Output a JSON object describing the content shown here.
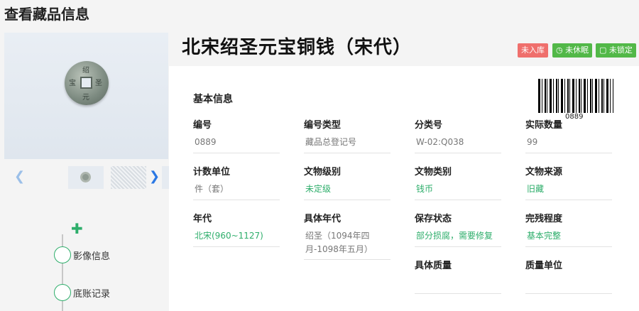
{
  "page": {
    "title": "查看藏品信息"
  },
  "object": {
    "title": "北宋绍圣元宝铜钱（宋代）",
    "coin_inscription": [
      "绍",
      "圣",
      "元",
      "宝"
    ]
  },
  "badges": [
    {
      "label": "未入库",
      "color": "#ef6f6c"
    },
    {
      "label": "未休眠",
      "icon": "clock-icon",
      "color": "#52b848"
    },
    {
      "label": "未锁定",
      "icon": "lock-icon",
      "color": "#52b848"
    }
  ],
  "gallery": {
    "prev_icon": "chevron-left-icon",
    "next_icon": "chevron-right-icon"
  },
  "timeline": {
    "add_icon": "plus-icon",
    "items": [
      "影像信息",
      "底账记录"
    ]
  },
  "section": {
    "title": "基本信息"
  },
  "barcode": {
    "number": "0889"
  },
  "fields": [
    {
      "label": "编号",
      "value": "0889"
    },
    {
      "label": "编号类型",
      "value": "藏品总登记号"
    },
    {
      "label": "分类号",
      "value": "W-02:Q038"
    },
    {
      "label": "实际数量",
      "value": "99"
    },
    {
      "label": "计数单位",
      "value": "件（套）"
    },
    {
      "label": "文物级别",
      "value": "未定级"
    },
    {
      "label": "文物类别",
      "value": "钱币"
    },
    {
      "label": "文物来源",
      "value": "旧藏"
    },
    {
      "label": "年代",
      "value": "北宋(960~1127)"
    },
    {
      "label": "具体年代",
      "value": "绍圣（1094年四月-1098年五月）"
    },
    {
      "label": "保存状态",
      "value": "部分损腐，需要修复"
    },
    {
      "label": "完残程度",
      "value": "基本完整"
    },
    {
      "label": "具体质量",
      "value": ""
    },
    {
      "label": "质量单位",
      "value": ""
    }
  ],
  "colors": {
    "accent_green": "#2eae6b",
    "badge_red": "#ef6f6c",
    "badge_green": "#52b848",
    "link_blue": "#2b78e4"
  }
}
